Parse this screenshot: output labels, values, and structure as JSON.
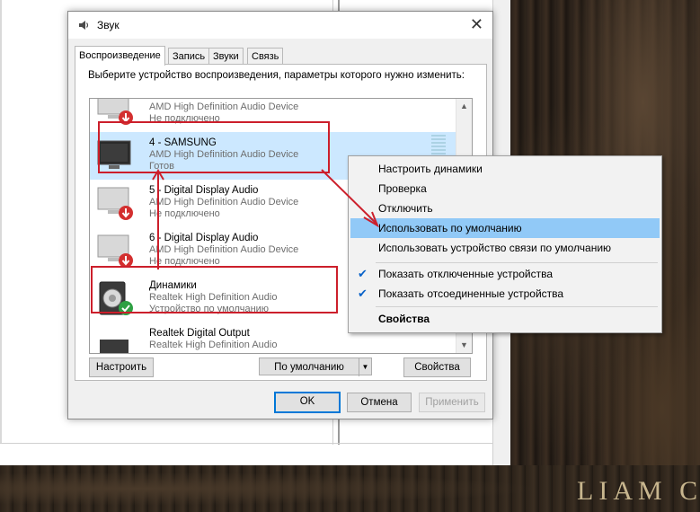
{
  "dialog": {
    "title": "Звук",
    "close_label": "✕",
    "tabs": [
      {
        "label": "Воспроизведение",
        "active": true
      },
      {
        "label": "Запись"
      },
      {
        "label": "Звуки"
      },
      {
        "label": "Связь"
      }
    ],
    "instruction": "Выберите устройство воспроизведения, параметры которого нужно изменить:",
    "devices": [
      {
        "name": "",
        "driver": "AMD High Definition Audio Device",
        "status": "Не подключено",
        "icon": "monitor-icon-disconnected"
      },
      {
        "name": "4 - SAMSUNG",
        "driver": "AMD High Definition Audio Device",
        "status": "Готов",
        "icon": "monitor-icon",
        "selected": true
      },
      {
        "name": "5 - Digital Display Audio",
        "driver": "AMD High Definition Audio Device",
        "status": "Не подключено",
        "icon": "monitor-icon-disconnected"
      },
      {
        "name": "6 - Digital Display Audio",
        "driver": "AMD High Definition Audio Device",
        "status": "Не подключено",
        "icon": "monitor-icon-disconnected"
      },
      {
        "name": "Динамики",
        "driver": "Realtek High Definition Audio",
        "status": "Устройство по умолчанию",
        "icon": "speaker-icon-default"
      },
      {
        "name": "Realtek Digital Output",
        "driver": "Realtek High Definition Audio",
        "status": "",
        "icon": "digital-output-icon"
      }
    ],
    "buttons": {
      "configure": "Настроить",
      "set_default": "По умолчанию",
      "properties": "Свойства",
      "ok": "OK",
      "cancel": "Отмена",
      "apply": "Применить"
    }
  },
  "context_menu": {
    "items": [
      {
        "label": "Настроить динамики"
      },
      {
        "label": "Проверка"
      },
      {
        "label": "Отключить"
      },
      {
        "label": "Использовать по умолчанию",
        "highlighted": true
      },
      {
        "label": "Использовать устройство связи по умолчанию"
      },
      {
        "label": "Показать отключенные устройства",
        "checked": true
      },
      {
        "label": "Показать отсоединенные устройства",
        "checked": true
      },
      {
        "label": "Свойства",
        "bold": true
      }
    ]
  },
  "background": {
    "corner_text": "LIAM C"
  },
  "colors": {
    "accent": "#0078d7",
    "selection": "#cce8ff",
    "menu_highlight": "#91c9f7",
    "annotation": "#cc1f2b"
  }
}
